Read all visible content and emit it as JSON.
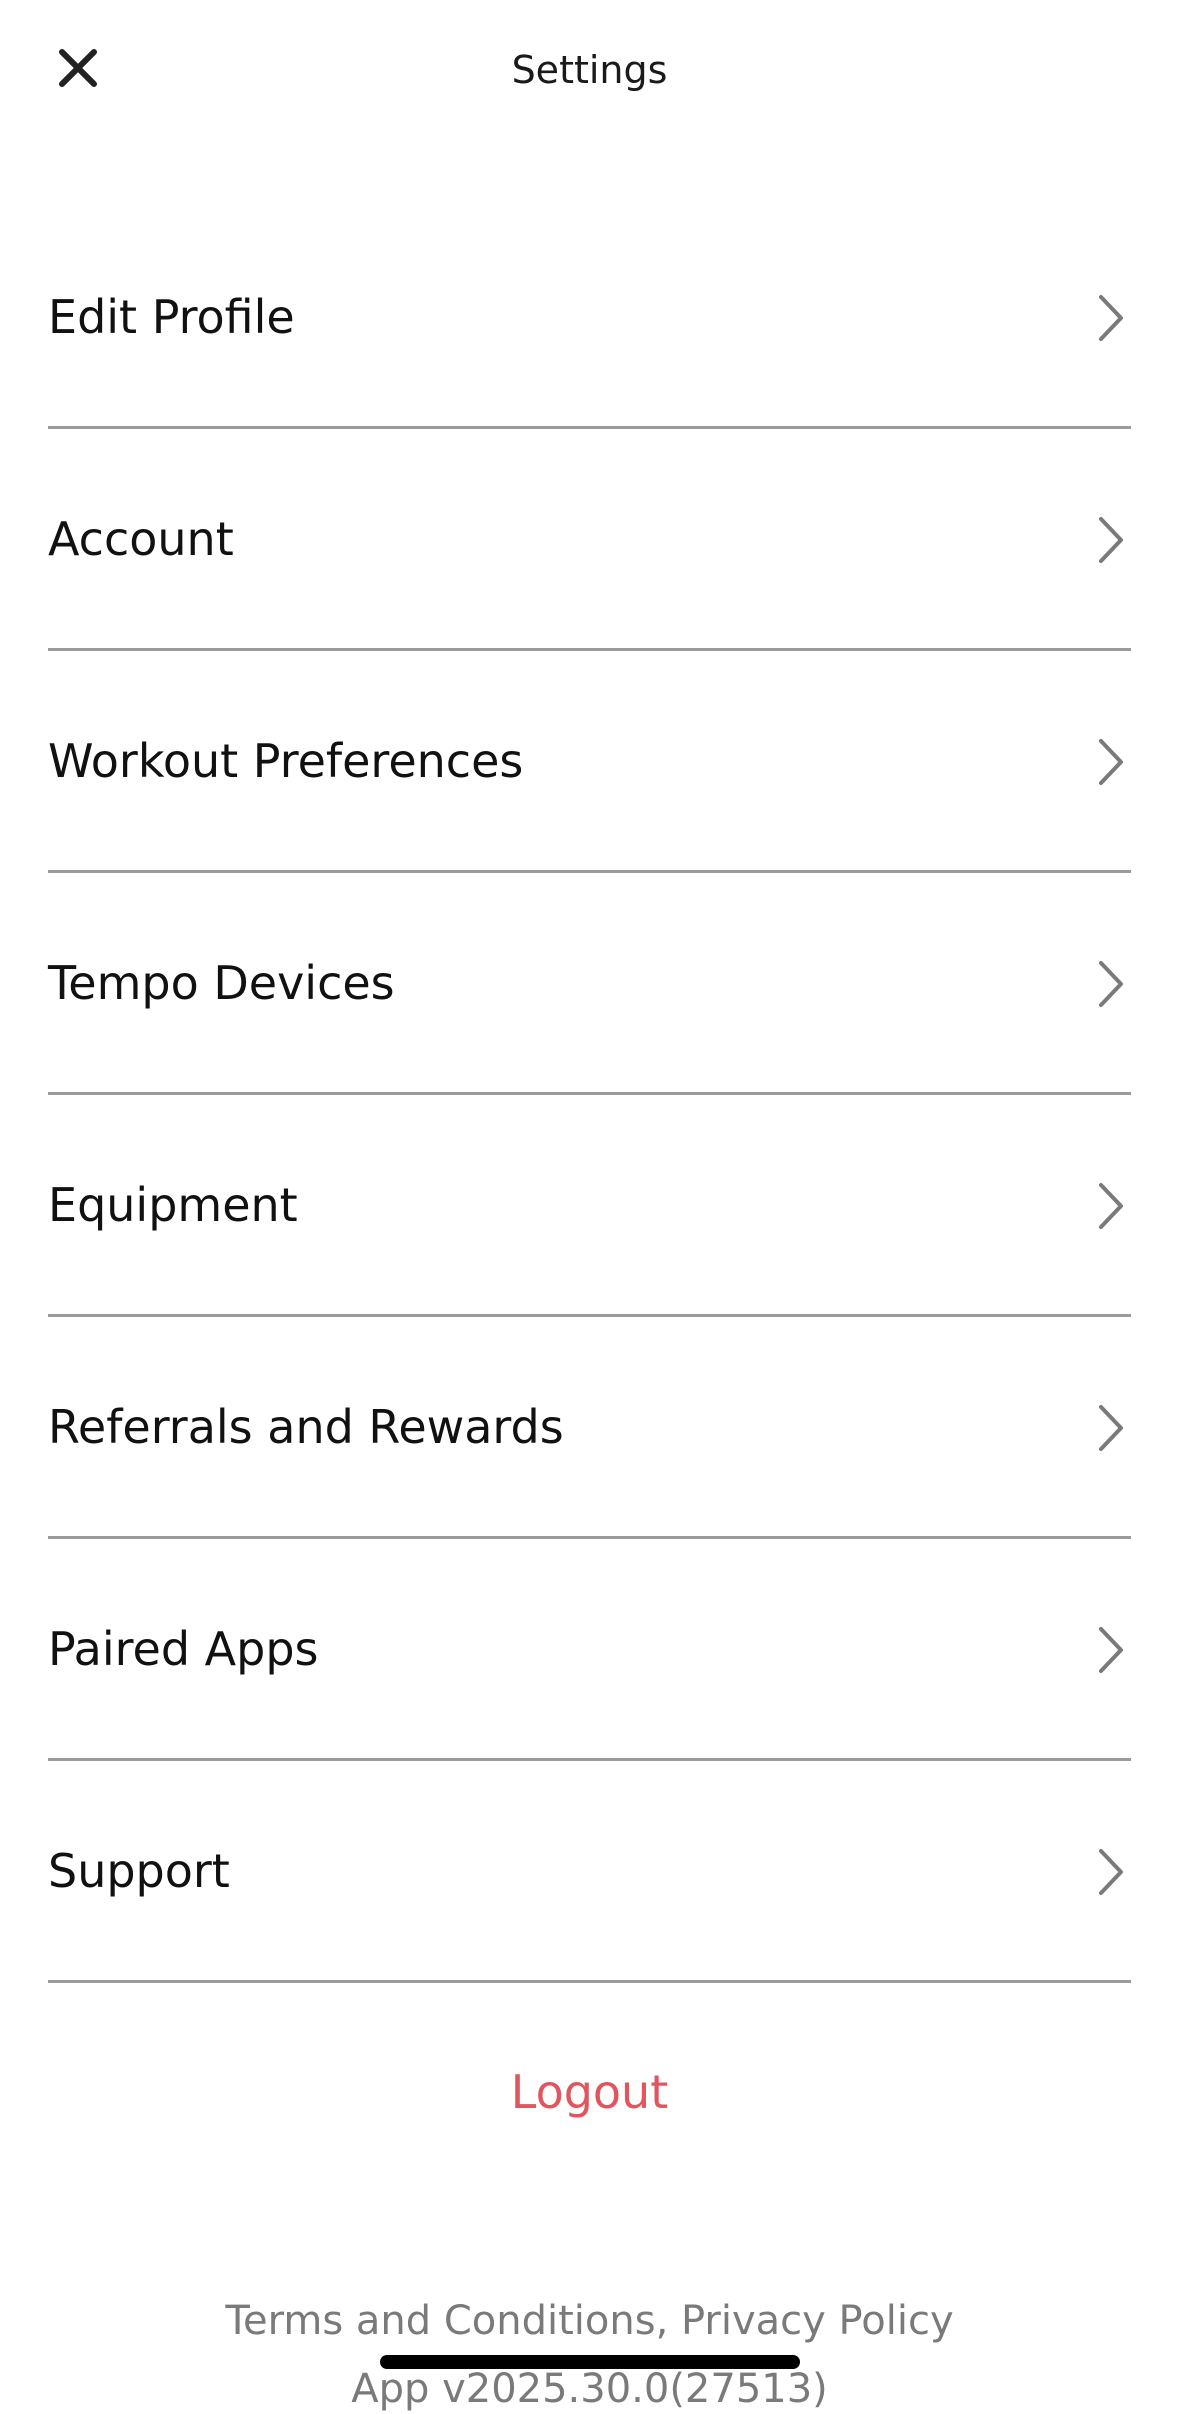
{
  "header": {
    "title": "Settings",
    "close_icon": "close-icon"
  },
  "menu": {
    "items": [
      {
        "label": "Edit Profile",
        "icon": "chevron-right-icon"
      },
      {
        "label": "Account",
        "icon": "chevron-right-icon"
      },
      {
        "label": "Workout Preferences",
        "icon": "chevron-right-icon"
      },
      {
        "label": "Tempo Devices",
        "icon": "chevron-right-icon"
      },
      {
        "label": "Equipment",
        "icon": "chevron-right-icon"
      },
      {
        "label": "Referrals and Rewards",
        "icon": "chevron-right-icon"
      },
      {
        "label": "Paired Apps",
        "icon": "chevron-right-icon"
      },
      {
        "label": "Support",
        "icon": "chevron-right-icon"
      }
    ]
  },
  "logout": {
    "label": "Logout",
    "color": "#e0555e"
  },
  "footer": {
    "terms": "Terms and Conditions",
    "separator": ", ",
    "privacy": "Privacy Policy",
    "version": "App v2025.30.0(27513)"
  }
}
